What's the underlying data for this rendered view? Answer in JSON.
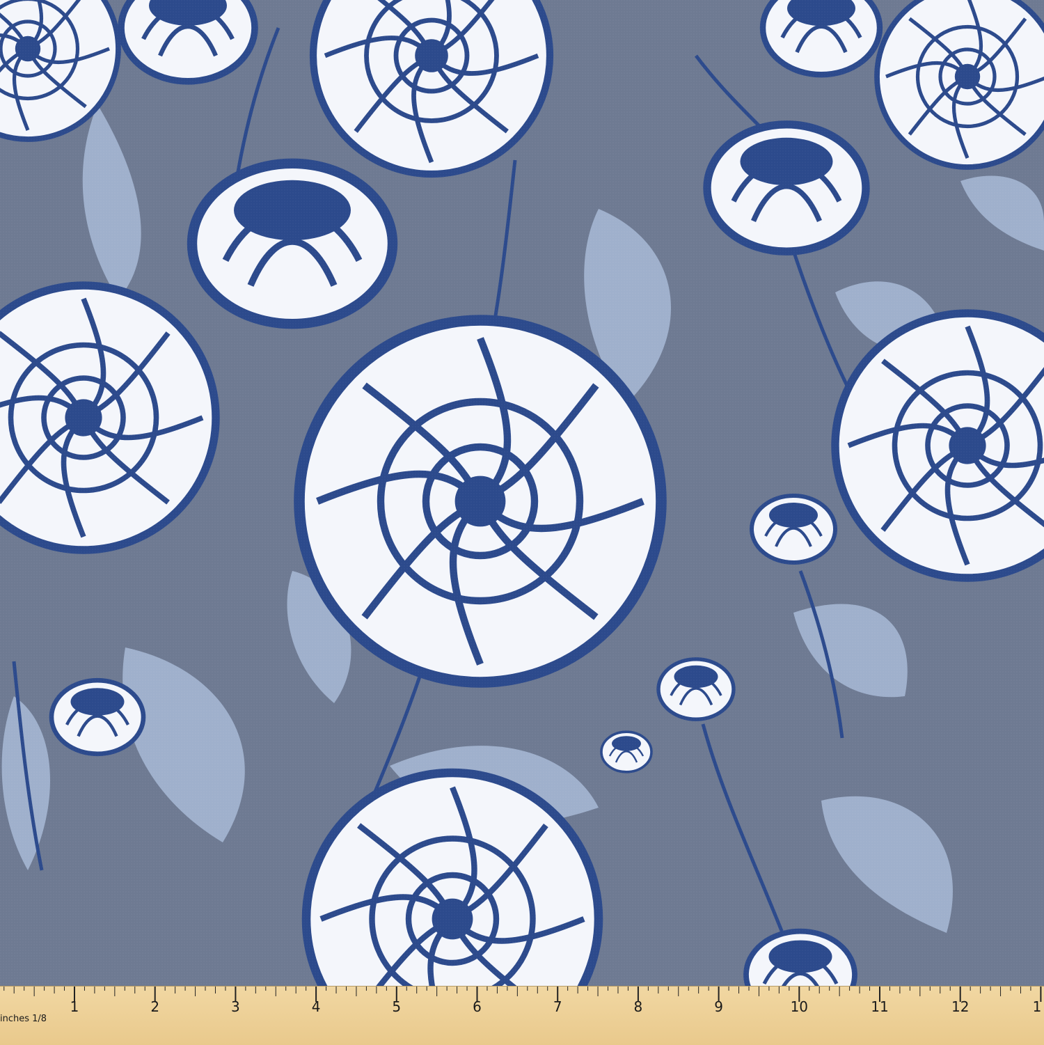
{
  "colors": {
    "background": "#6e7a92",
    "leaf": "#9fb0cc",
    "ink": "#2c4a8c",
    "petal": "#f4f6fb",
    "ruler": "#f1d7a2"
  },
  "ruler": {
    "unit_label": "inches 1/8",
    "numbers": [
      "1",
      "2",
      "3",
      "4",
      "5",
      "6",
      "7",
      "8",
      "9",
      "10",
      "11",
      "12",
      "1"
    ]
  }
}
